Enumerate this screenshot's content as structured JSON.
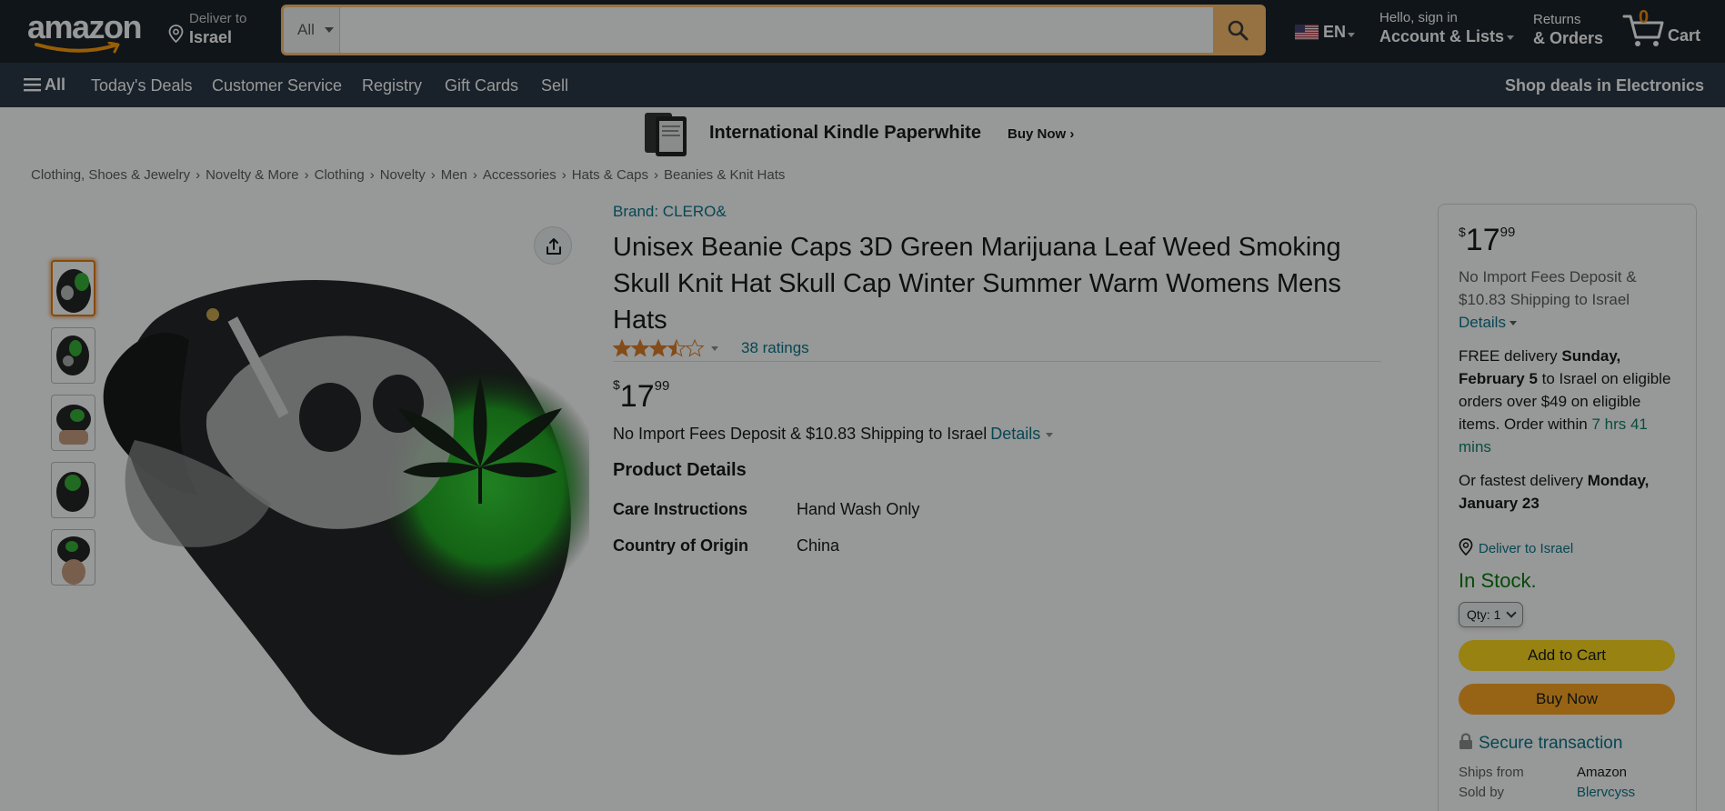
{
  "header": {
    "logo_text": "amazon",
    "deliver_line1": "Deliver to",
    "deliver_line2": "Israel",
    "search_category": "All",
    "search_placeholder": "",
    "lang_code": "EN",
    "account_line1": "Hello, sign in",
    "account_line2": "Account & Lists",
    "returns_line1": "Returns",
    "returns_line2": "& Orders",
    "cart_count": "0",
    "cart_label": "Cart"
  },
  "subnav": {
    "all_label": "All",
    "links": [
      "Today's Deals",
      "Customer Service",
      "Registry",
      "Gift Cards",
      "Sell"
    ],
    "deals": "Shop deals in Electronics"
  },
  "banner": {
    "title": "International Kindle Paperwhite",
    "buy_now": "Buy Now ›"
  },
  "breadcrumb": [
    "Clothing, Shoes & Jewelry",
    "Novelty & More",
    "Clothing",
    "Novelty",
    "Men",
    "Accessories",
    "Hats & Caps",
    "Beanies & Knit Hats"
  ],
  "product": {
    "brand": "Brand: CLERO&",
    "title": "Unisex Beanie Caps 3D Green Marijuana Leaf Weed Smoking Skull Knit Hat Skull Cap Winter Summer Warm Womens Mens Hats",
    "rating": 3.5,
    "ratings_count": "38 ratings",
    "price_symbol": "$",
    "price_whole": "17",
    "price_fraction": "99",
    "fees_text": "No Import Fees Deposit & $10.83 Shipping to Israel",
    "details_label": "Details",
    "details_heading": "Product Details",
    "details": [
      {
        "key": "Care Instructions",
        "value": "Hand Wash Only"
      },
      {
        "key": "Country of Origin",
        "value": "China"
      }
    ]
  },
  "buybox": {
    "price_symbol": "$",
    "price_whole": "17",
    "price_fraction": "99",
    "fees_text": "No Import Fees Deposit & $10.83 Shipping to Israel",
    "details_label": "Details",
    "delivery_pre": "FREE delivery ",
    "delivery_date": "Sunday, February 5",
    "delivery_mid": " to Israel on eligible orders over $49 on eligible items. Order within ",
    "delivery_timer": "7 hrs 41 mins",
    "fastest_pre": "Or fastest delivery ",
    "fastest_date": "Monday, January 23",
    "deliver_to": "Deliver to Israel",
    "in_stock": "In Stock.",
    "qty_label": "Qty:",
    "qty_value": "1",
    "add_to_cart": "Add to Cart",
    "buy_now": "Buy Now",
    "secure": "Secure transaction",
    "ships_from_label": "Ships from",
    "ships_from_value": "Amazon",
    "sold_by_label": "Sold by",
    "sold_by_value": "Blervcyss"
  },
  "colors": {
    "nav_bg": "#131921",
    "subnav_bg": "#232f3e",
    "search_accent": "#febd69",
    "link": "#007185",
    "add_to_cart": "#ffd814",
    "buy_now": "#ffa41c",
    "in_stock": "#007600"
  },
  "icons": [
    "location-pin-icon",
    "search-icon",
    "us-flag-icon",
    "cart-icon",
    "hamburger-icon",
    "share-icon",
    "lock-icon",
    "star-icon"
  ]
}
